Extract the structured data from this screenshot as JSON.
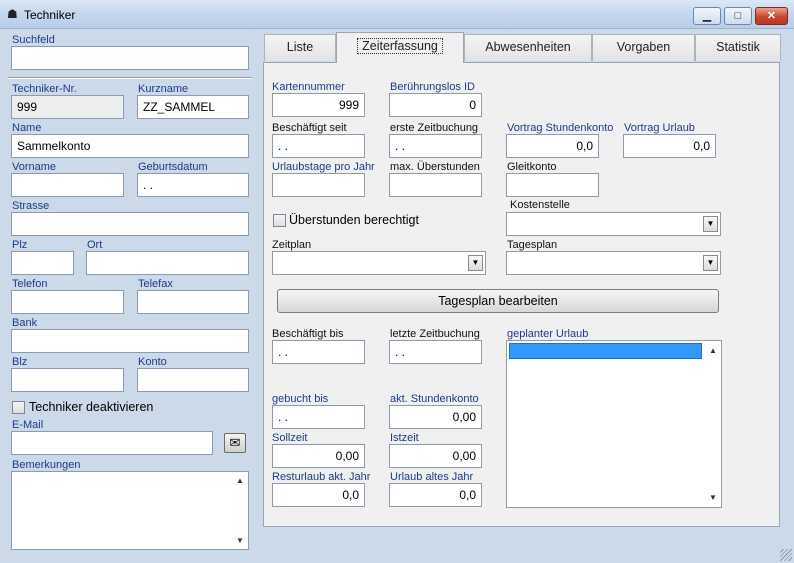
{
  "window": {
    "title": "Techniker",
    "minimize": "▁",
    "maximize": "□",
    "close": "✕"
  },
  "left": {
    "suchfeld": {
      "label": "Suchfeld",
      "value": ""
    },
    "techniker_nr": {
      "label": "Techniker-Nr.",
      "value": "999"
    },
    "kurzname": {
      "label": "Kurzname",
      "value": "ZZ_SAMMEL"
    },
    "name": {
      "label": "Name",
      "value": "Sammelkonto"
    },
    "vorname": {
      "label": "Vorname",
      "value": ""
    },
    "geburtsdatum": {
      "label": "Geburtsdatum",
      "value": " .  ."
    },
    "strasse": {
      "label": "Strasse",
      "value": ""
    },
    "plz": {
      "label": "Plz",
      "value": ""
    },
    "ort": {
      "label": "Ort",
      "value": ""
    },
    "telefon": {
      "label": "Telefon",
      "value": ""
    },
    "telefax": {
      "label": "Telefax",
      "value": ""
    },
    "bank": {
      "label": "Bank",
      "value": ""
    },
    "blz": {
      "label": "Blz",
      "value": ""
    },
    "konto": {
      "label": "Konto",
      "value": ""
    },
    "deaktivieren": {
      "label": "Techniker deaktivieren",
      "checked": false
    },
    "email": {
      "label": "E-Mail",
      "value": ""
    },
    "bemerkungen": {
      "label": "Bemerkungen",
      "value": ""
    }
  },
  "tabs": [
    "Liste",
    "Zeiterfassung",
    "Abwesenheiten",
    "Vorgaben",
    "Statistik"
  ],
  "active_tab": "Zeiterfassung",
  "zeit": {
    "kartennummer": {
      "label": "Kartennummer",
      "value": "999"
    },
    "beruehrungslos_id": {
      "label": "Berührungslos ID",
      "value": "0"
    },
    "beschaeftigt_seit": {
      "label": "Beschäftigt seit",
      "value": " .  ."
    },
    "erste_zeitbuchung": {
      "label": "erste Zeitbuchung",
      "value": " .  ."
    },
    "vortrag_stundenkonto": {
      "label": "Vortrag Stundenkonto",
      "value": "0,0"
    },
    "vortrag_urlaub": {
      "label": "Vortrag Urlaub",
      "value": "0,0"
    },
    "urlaubstage_pro_jahr": {
      "label": "Urlaubstage pro Jahr",
      "value": ""
    },
    "max_ueberstunden": {
      "label": "max. Überstunden",
      "value": ""
    },
    "gleitkonto": {
      "label": "Gleitkonto",
      "value": ""
    },
    "ueberstunden_berechtigt": {
      "label": "Überstunden berechtigt",
      "checked": false
    },
    "kostenstelle": {
      "label": "Kostenstelle",
      "value": ""
    },
    "zeitplan": {
      "label": "Zeitplan",
      "value": ""
    },
    "tagesplan": {
      "label": "Tagesplan",
      "value": ""
    },
    "tagesplan_button": "Tagesplan bearbeiten",
    "beschaeftigt_bis": {
      "label": "Beschäftigt bis",
      "value": " .  ."
    },
    "letzte_zeitbuchung": {
      "label": "letzte Zeitbuchung",
      "value": " .  ."
    },
    "geplanter_urlaub": {
      "label": "geplanter Urlaub"
    },
    "gebucht_bis": {
      "label": "gebucht bis",
      "value": " .  ."
    },
    "akt_stundenkonto": {
      "label": "akt. Stundenkonto",
      "value": "0,00"
    },
    "sollzeit": {
      "label": "Sollzeit",
      "value": "0,00"
    },
    "istzeit": {
      "label": "Istzeit",
      "value": "0,00"
    },
    "resturlaub": {
      "label": "Resturlaub akt. Jahr",
      "value": "0,0"
    },
    "urlaub_altes_jahr": {
      "label": "Urlaub altes Jahr",
      "value": "0,0"
    }
  }
}
